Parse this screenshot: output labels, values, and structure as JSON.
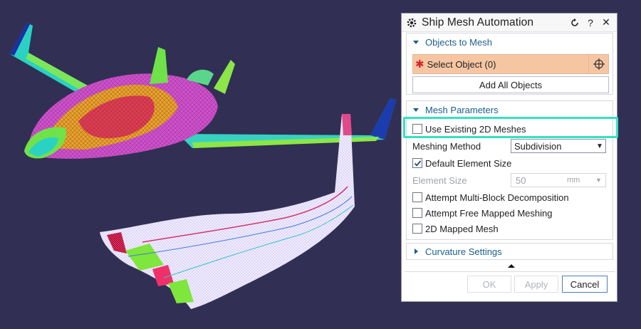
{
  "dialog": {
    "title": "Ship Mesh Automation",
    "title_icons": [
      "gear-icon",
      "reset-icon",
      "help-icon",
      "close-icon"
    ],
    "help_glyph": "?",
    "close_glyph": "✕"
  },
  "objects_section": {
    "header": "Objects to Mesh",
    "required_mark": "✱",
    "select_label": "Select Object (0)",
    "add_all_label": "Add All Objects"
  },
  "mesh_section": {
    "header": "Mesh Parameters",
    "use_existing_label": "Use Existing 2D Meshes",
    "use_existing_checked": false,
    "method_label": "Meshing Method",
    "method_value": "Subdivision",
    "default_size_label": "Default Element Size",
    "default_size_checked": true,
    "element_size_label": "Element Size",
    "element_size_value": "50",
    "element_size_unit": "mm",
    "multi_block_label": "Attempt Multi-Block Decomposition",
    "free_mapped_label": "Attempt Free Mapped Meshing",
    "mapped_2d_label": "2D Mapped Mesh"
  },
  "curvature_section": {
    "header": "Curvature Settings"
  },
  "footer": {
    "ok_label": "OK",
    "apply_label": "Apply",
    "cancel_label": "Cancel"
  },
  "colors": {
    "background": "#312f53",
    "accent": "#1b5e8c",
    "selection": "#f6c6a3",
    "highlight": "#33e2c0"
  }
}
